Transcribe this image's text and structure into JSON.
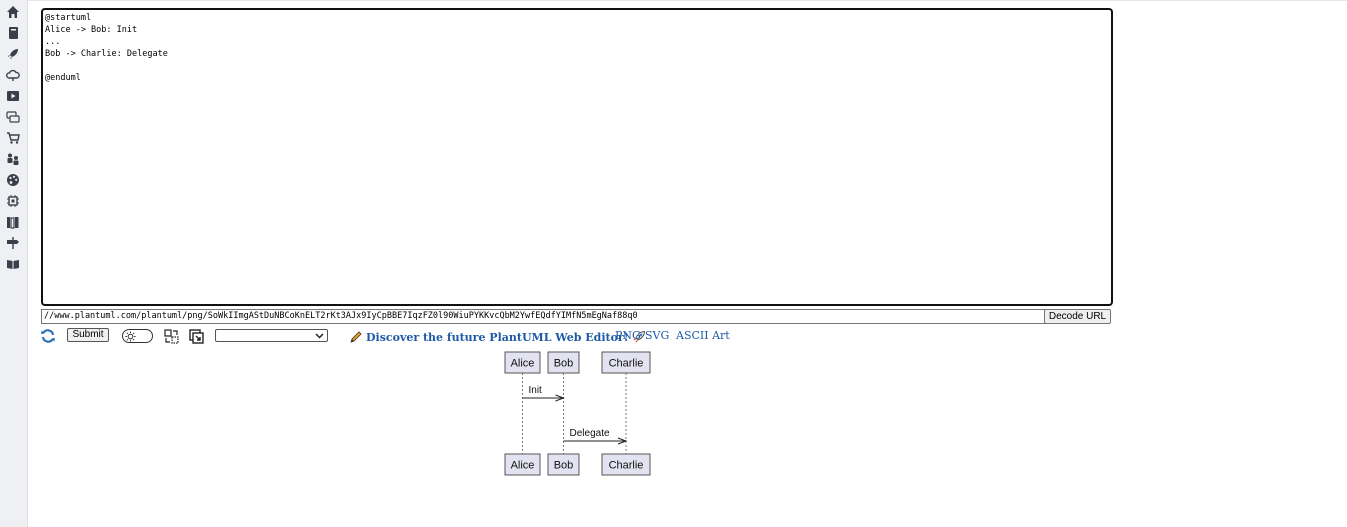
{
  "sidebar": {
    "icons": [
      "home-icon",
      "book-icon",
      "rocket-icon",
      "cloud-icon",
      "play-icon",
      "chat-icon",
      "cart-icon",
      "people-icon",
      "palette-icon",
      "chip-icon",
      "library-icon",
      "signpost-icon",
      "reader-icon"
    ]
  },
  "editor": {
    "text": "@startuml\nAlice -> Bob: Init\n...\nBob -> Charlie: Delegate\n\n@enduml"
  },
  "url_bar": {
    "value": "//www.plantuml.com/plantuml/png/SoWkIImgAStDuNBCoKnELT2rKt3AJx9IyCpBBE7IqzFZ0l90WiuPYKKvcQbM2YwfEQdfYIMfN5mEgNaf88q0",
    "decode_label": "Decode URL"
  },
  "toolbar": {
    "submit_label": "Submit",
    "select_value": ""
  },
  "promo": {
    "text": "Discover the future PlantUML Web Editor!"
  },
  "export_links": [
    "PNG",
    "SVG",
    "ASCII Art"
  ],
  "diagram": {
    "participants": [
      "Alice",
      "Bob",
      "Charlie"
    ],
    "messages": [
      {
        "from": "Alice",
        "to": "Bob",
        "label": "Init"
      },
      {
        "from": "Bob",
        "to": "Charlie",
        "label": "Delegate"
      }
    ]
  }
}
